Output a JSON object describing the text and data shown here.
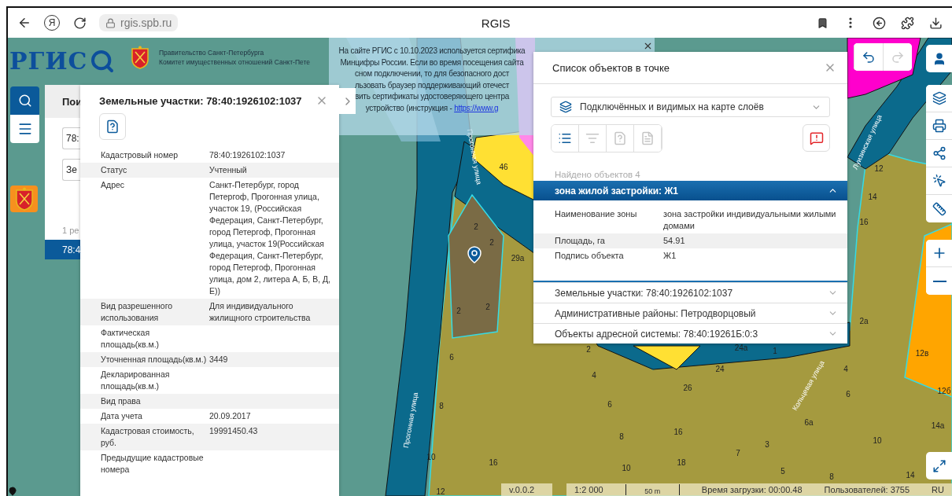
{
  "browser": {
    "home_glyph": "Я",
    "url": "rgis.spb.ru",
    "title": "RGIS"
  },
  "header": {
    "logo": "РГИС",
    "org_lines": [
      "Правительство Санкт-Петербурга",
      "Комитет имущественных отношений Санкт-Пете"
    ]
  },
  "notice": {
    "lines": [
      "На сайте РГИС с 10.10.2023 используется сертифика",
      "Минцифры России. Если во время посещения сайта",
      "сном подключении, то для безопасного дост",
      "льзовать браузер поддерживающий отечест",
      "вить сертификаты удостоверяющего центра",
      "устройство (инструкция - "
    ],
    "link": "https://www.g"
  },
  "search_panel": {
    "tab": "Пои",
    "fields": [
      "78:",
      "Зе"
    ],
    "result_count": "1 ре",
    "results": [
      {
        "label": "78:4",
        "selected": true
      }
    ]
  },
  "parcel_panel": {
    "title": "Земельные участки: 78:40:1926102:1037",
    "rows": [
      {
        "label": "Кадастровый номер",
        "value": "78:40:1926102:1037"
      },
      {
        "label": "Статус",
        "value": "Учтенный"
      },
      {
        "label": "Адрес",
        "value": "Санкт-Петербург, город Петергоф, Прогонная улица, участок 19, (Российская Федерация, Санкт-Петербург, город Петергоф, Прогонная улица, участок 19(Российская Федерация, Санкт-Петербург, город Петергоф, Прогонная улица, дом 2, литера А, Б, В, Д, Е))"
      },
      {
        "label": "Вид разрешенного использования",
        "value": "Для индивидуального жилищного строительства"
      },
      {
        "label": "Фактическая площадь(кв.м.)"
      },
      {
        "label": "Уточненная площадь(кв.м.)",
        "value": "3449"
      },
      {
        "label": "Декларированная площадь(кв.м.)"
      },
      {
        "label": "Вид права"
      },
      {
        "label": "Дата учета",
        "value": "20.09.2017"
      },
      {
        "label": "Кадастровая стоимость, руб.",
        "value": "19991450.43"
      },
      {
        "label": "Предыдущие кадастровые номера"
      }
    ]
  },
  "objects_panel": {
    "title": "Список объектов в точке",
    "layer_filter": "Подключённых и видимых на карте слоёв",
    "tools": [
      {
        "kind": "list",
        "disabled": false
      },
      {
        "kind": "area",
        "disabled": true
      },
      {
        "kind": "frame",
        "disabled": true
      },
      {
        "kind": "doc",
        "disabled": true
      }
    ],
    "found": "Найдено объектов 4",
    "items": [
      {
        "title": "зона жилой застройки: Ж1",
        "expanded": true,
        "rows": [
          {
            "label": "Наименование зоны",
            "value": "зона застройки индивидуальными жилыми домами"
          },
          {
            "label": "Площадь, га",
            "value": "54.91"
          },
          {
            "label": "Подпись объекта",
            "value": "Ж1"
          }
        ]
      },
      {
        "title": "Земельные участки: 78:40:1926102:1037",
        "expanded": false
      },
      {
        "title": "Административные районы: Петродворцовый",
        "expanded": false
      },
      {
        "title": "Объекты адресной системы: 78:40:19261Б:0:3",
        "expanded": false
      }
    ]
  },
  "map": {
    "labels": [
      "46",
      "2",
      "2",
      "2",
      "2",
      "29а",
      "6",
      "8",
      "10",
      "16",
      "12",
      "2",
      "4",
      "6",
      "8",
      "10",
      "16",
      "18",
      "26",
      "24",
      "24а",
      "1",
      "4",
      "6",
      "6а",
      "3",
      "7",
      "5",
      "8",
      "10",
      "14",
      "14а",
      "12б",
      "12в",
      "2а",
      "12",
      "14",
      "16"
    ],
    "streets": [
      "Прогонная улица",
      "Прогонная улица",
      "Луизинская улица",
      "Кольцевая улица"
    ]
  },
  "status_bar": {
    "version": "v.0.0.2",
    "scale": "1:2 000",
    "scale_bar": "50 m",
    "load_time": "Время загрузки: 00:00.48",
    "users": "Пользователей: 3755",
    "language": "RU"
  }
}
